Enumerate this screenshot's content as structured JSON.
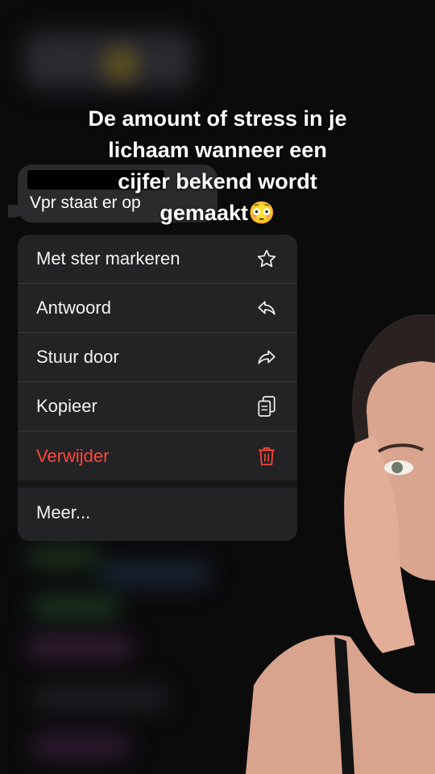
{
  "overlay": {
    "caption_lines": [
      "De amount of stress in je",
      "lichaam wanneer een",
      "cijfer bekend wordt",
      "gemaakt😳"
    ]
  },
  "message": {
    "text": "Vpr staat er op"
  },
  "menu": {
    "items": [
      {
        "label": "Met ster markeren",
        "icon": "star-icon"
      },
      {
        "label": "Antwoord",
        "icon": "reply-icon"
      },
      {
        "label": "Stuur door",
        "icon": "forward-icon"
      },
      {
        "label": "Kopieer",
        "icon": "copy-icon"
      },
      {
        "label": "Verwijder",
        "icon": "trash-icon"
      },
      {
        "label": "Meer..."
      }
    ],
    "danger_color": "#ff453a"
  }
}
